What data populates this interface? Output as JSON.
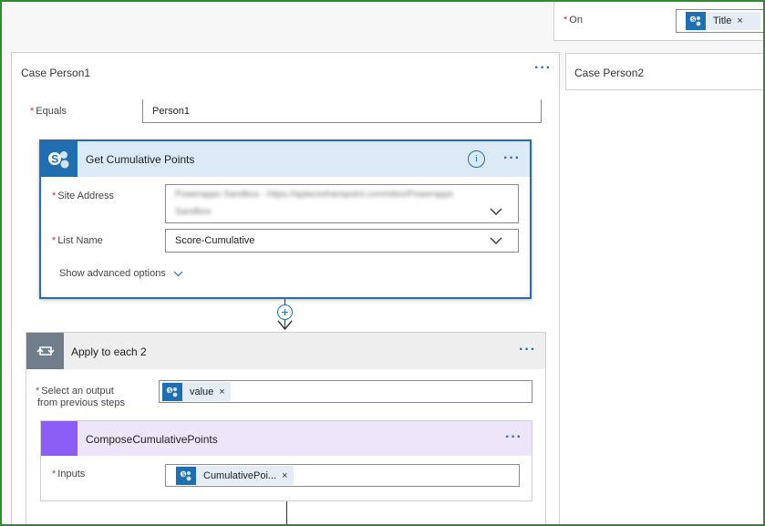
{
  "on_field": {
    "label": "On",
    "token": {
      "icon": "sharepoint-icon",
      "label": "Title",
      "remove": "×"
    }
  },
  "case1": {
    "title": "Case Person1",
    "more": "···",
    "equals_label": "Equals",
    "equals_value": "Person1"
  },
  "case2": {
    "title": "Case Person2"
  },
  "get_action": {
    "title": "Get Cumulative Points",
    "info_icon": "info-icon",
    "more": "···",
    "site_address_label": "Site Address",
    "site_address_value": "Powerapps Sandbox - https://aplacesharepoint.com/sites/Powerapps",
    "site_address_value2": "Sandbox",
    "list_name_label": "List Name",
    "list_name_value": "Score-Cumulative",
    "advanced_link": "Show advanced options"
  },
  "apply_each": {
    "title": "Apply to each 2",
    "more": "···",
    "select_label_line1": "Select an output",
    "select_label_line2": "from previous steps",
    "token": {
      "icon": "sharepoint-icon",
      "label": "value",
      "remove": "×"
    }
  },
  "compose": {
    "title": "ComposeCumulativePoints",
    "more": "···",
    "inputs_label": "Inputs",
    "token": {
      "icon": "sharepoint-icon",
      "label": "CumulativePoi...",
      "remove": "×"
    }
  },
  "colors": {
    "frame": "#2e8b2e",
    "sharepoint": "#1f6fb0",
    "action_header": "#dce9f6",
    "loop_header": "#eeeeee",
    "loop_icon": "#6f7e8a",
    "compose_icon": "#8c5ef6",
    "compose_header": "#ede6fb",
    "link": "#1e6fbf"
  }
}
